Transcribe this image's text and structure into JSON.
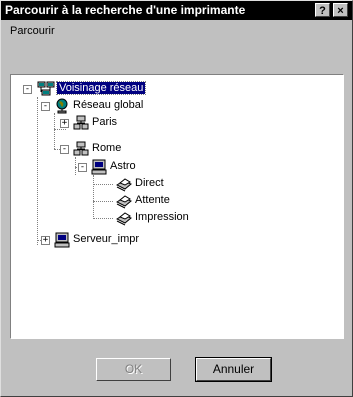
{
  "dialog": {
    "title": "Parcourir à la recherche d'une imprimante",
    "help_label": "?",
    "close_label": "×",
    "subtitle": "Parcourir"
  },
  "tree": {
    "nodes": [
      {
        "label": "Voisinage réseau",
        "icon": "network-neighborhood-icon",
        "expanded": true,
        "selected": true
      },
      {
        "label": "Réseau global",
        "icon": "globe-icon",
        "expanded": true
      },
      {
        "label": "Paris",
        "icon": "workgroup-icon",
        "expanded": false
      },
      {
        "label": "Rome",
        "icon": "workgroup-icon",
        "expanded": true
      },
      {
        "label": "Astro",
        "icon": "computer-icon",
        "expanded": true
      },
      {
        "label": "Direct",
        "icon": "printer-icon"
      },
      {
        "label": "Attente",
        "icon": "printer-icon"
      },
      {
        "label": "Impression",
        "icon": "printer-icon"
      },
      {
        "label": "Serveur_impr",
        "icon": "computer-icon",
        "expanded": false
      }
    ]
  },
  "buttons": {
    "ok_label": "OK",
    "cancel_label": "Annuler"
  }
}
